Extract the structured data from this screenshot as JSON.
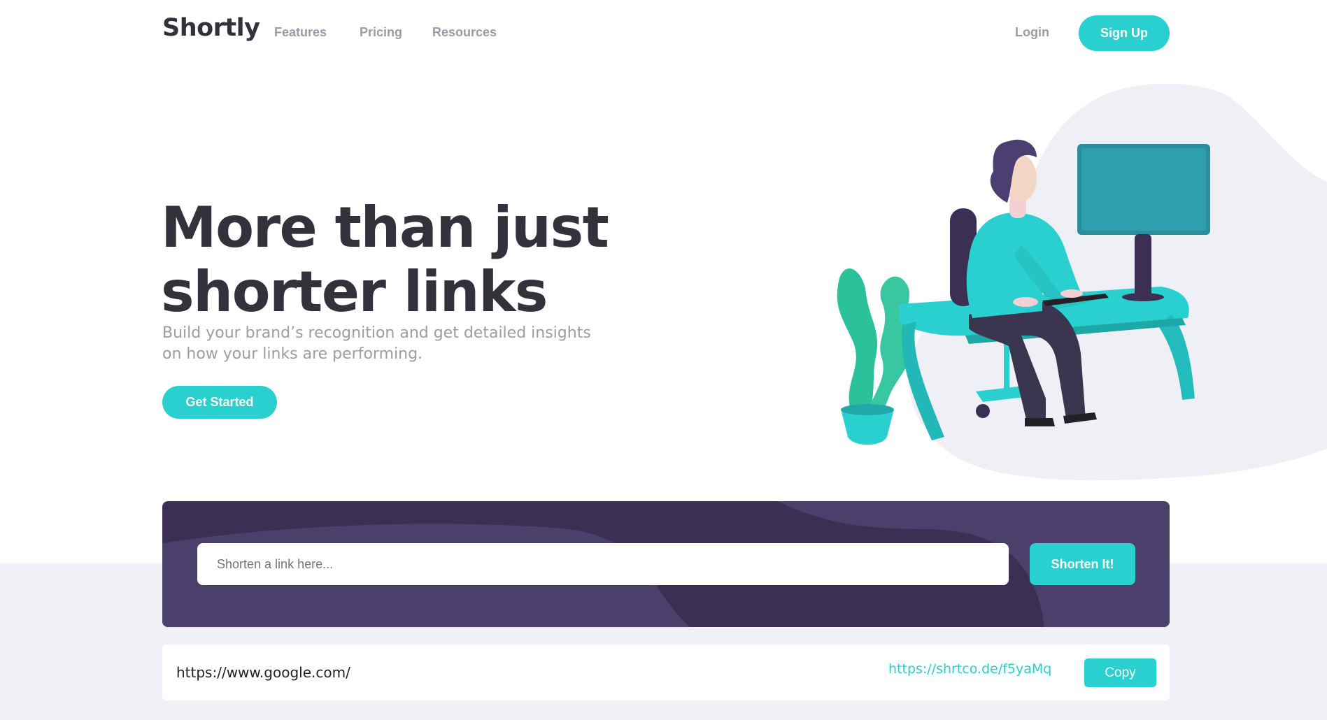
{
  "header": {
    "logo": "Shortly",
    "nav": [
      "Features",
      "Pricing",
      "Resources"
    ],
    "login_label": "Login",
    "signup_label": "Sign Up"
  },
  "hero": {
    "title_line1": "More than just",
    "title_line2": "shorter links",
    "subtitle_line1": "Build your brand’s recognition and get detailed insights",
    "subtitle_line2": "on how your links are performing.",
    "cta_label": "Get Started"
  },
  "shorten": {
    "placeholder": "Shorten a link here...",
    "button_label": "Shorten It!"
  },
  "results": [
    {
      "original": "https://www.google.com/",
      "short": "https://shrtco.de/f5yaMq",
      "copy_label": "Copy"
    }
  ],
  "colors": {
    "accent": "#2acfcf",
    "dark_violet": "#3b3054",
    "very_dark_text": "#34313d",
    "gray_text": "#9e9aa8",
    "light_bg": "#f0f1f6"
  }
}
